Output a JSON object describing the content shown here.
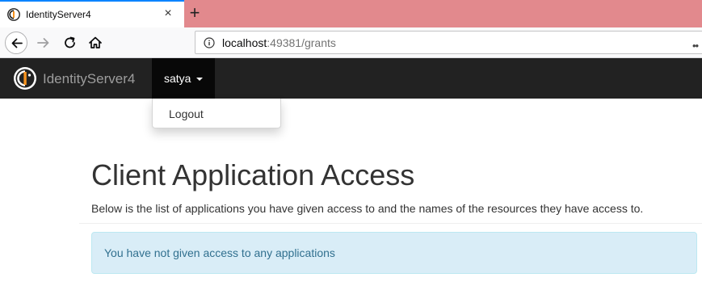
{
  "browser": {
    "tab_title": "IdentityServer4",
    "close_glyph": "×",
    "new_tab_glyph": "+",
    "url_host": "localhost",
    "url_rest": ":49381/grants",
    "page_actions_glyph": "••"
  },
  "navbar": {
    "brand": "IdentityServer4",
    "user_name": "satya",
    "dropdown_items": [
      {
        "label": "Logout"
      }
    ]
  },
  "main": {
    "title": "Client Application Access",
    "description": "Below is the list of applications you have given access to and the names of the resources they have access to.",
    "empty_message": "You have not given access to any applications"
  },
  "colors": {
    "navbar_bg": "#222222",
    "active_menu_bg": "#080808",
    "alert_bg": "#d9edf7",
    "alert_text": "#31708f",
    "tabstrip_bg": "#e2898d",
    "brand_accent": "#f7931e"
  },
  "icons": {
    "favicon": "identityserver-logo-icon",
    "back": "arrow-left-icon",
    "forward": "arrow-right-icon",
    "reload": "reload-icon",
    "home": "home-icon",
    "info": "info-icon",
    "caret": "caret-down-icon"
  }
}
